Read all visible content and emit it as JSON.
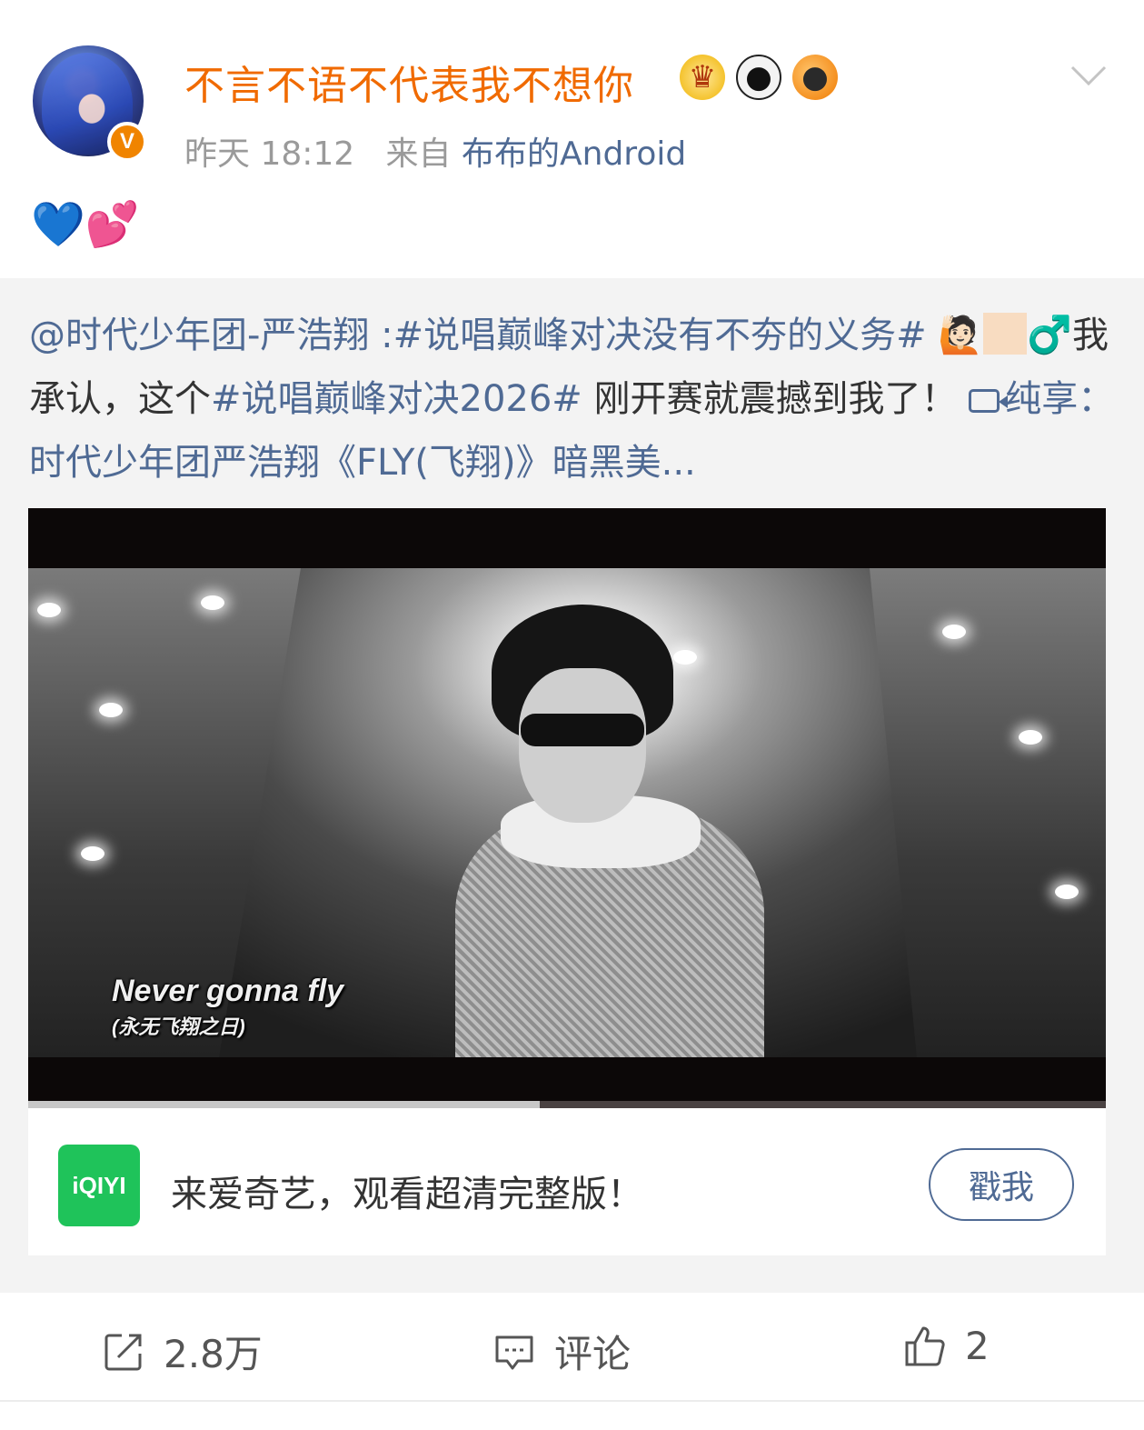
{
  "post": {
    "username": "不言不语不代表我不想你",
    "badges": [
      "crown-badge",
      "panda-badge",
      "fish-badge"
    ],
    "verified_label": "V",
    "time": "昨天 18:12",
    "source_prefix": "来自",
    "source": "布布的Android",
    "emojis": "💙💕"
  },
  "repost": {
    "mention": "@时代少年团-严浩翔",
    "sep": " :",
    "topic1": "#说唱巅峰对决没有不夯的义务#",
    "emoji1": "🙋🏻",
    "emoji2": "♂️",
    "text1": "我承认，这个",
    "topic2": "#说唱巅峰对决2026#",
    "text2": " 刚开赛就震撼到我了！",
    "video_link": "纯享：时代少年团严浩翔《FLY(飞翔)》暗黑美..."
  },
  "video": {
    "subtitle_en": "Never gonna fly",
    "subtitle_zh": "(永无飞翔之日)",
    "progress_fraction": 0.475
  },
  "ad": {
    "logo_text": "iQIYI",
    "text": "来爱奇艺，观看超清完整版！",
    "button": "戳我"
  },
  "actions": {
    "repost_count": "2.8万",
    "comment_label": "评论",
    "like_count": "2"
  },
  "colors": {
    "username": "#f06a00",
    "link": "#4f6a94",
    "iqiyi_green": "#1fc35a"
  }
}
